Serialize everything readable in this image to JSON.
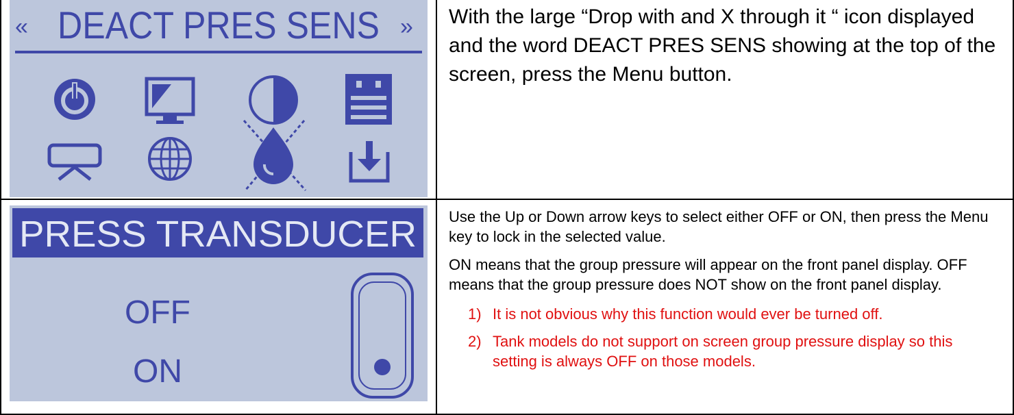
{
  "row1": {
    "screen": {
      "title_left_chevron": "«",
      "title": "DEACT PRES SENS",
      "title_right_chevron": "»",
      "icons": [
        "power-icon",
        "monitor-icon",
        "contrast-icon",
        "calendar-icon",
        "tray-icon",
        "globe-icon",
        "drop-x-icon",
        "download-icon"
      ]
    },
    "instruction": "With the large “Drop with and X through it “ icon displayed and the word DEACT PRES SENS showing at the top of the screen, press the Menu button."
  },
  "row2": {
    "screen": {
      "title": "PRESS TRANSDUCER",
      "option_off": "OFF",
      "option_on": "ON",
      "selector_position": "bottom"
    },
    "paragraph1": "Use the Up or Down arrow keys to select either OFF or ON, then press the Menu key to lock in the selected value.",
    "paragraph2": "ON means that the group pressure will appear on the front panel display. OFF means that the group pressure does NOT show on the front panel display.",
    "notes": [
      {
        "num": "1)",
        "text": "It is not obvious why this function would ever be turned off."
      },
      {
        "num": "2)",
        "text": "Tank models do not support on screen group pressure display so this setting is always OFF on those models."
      }
    ],
    "note_color": "#e01010"
  },
  "lcd_colors": {
    "background": "#bcc6dc",
    "foreground": "#3f48a8"
  }
}
